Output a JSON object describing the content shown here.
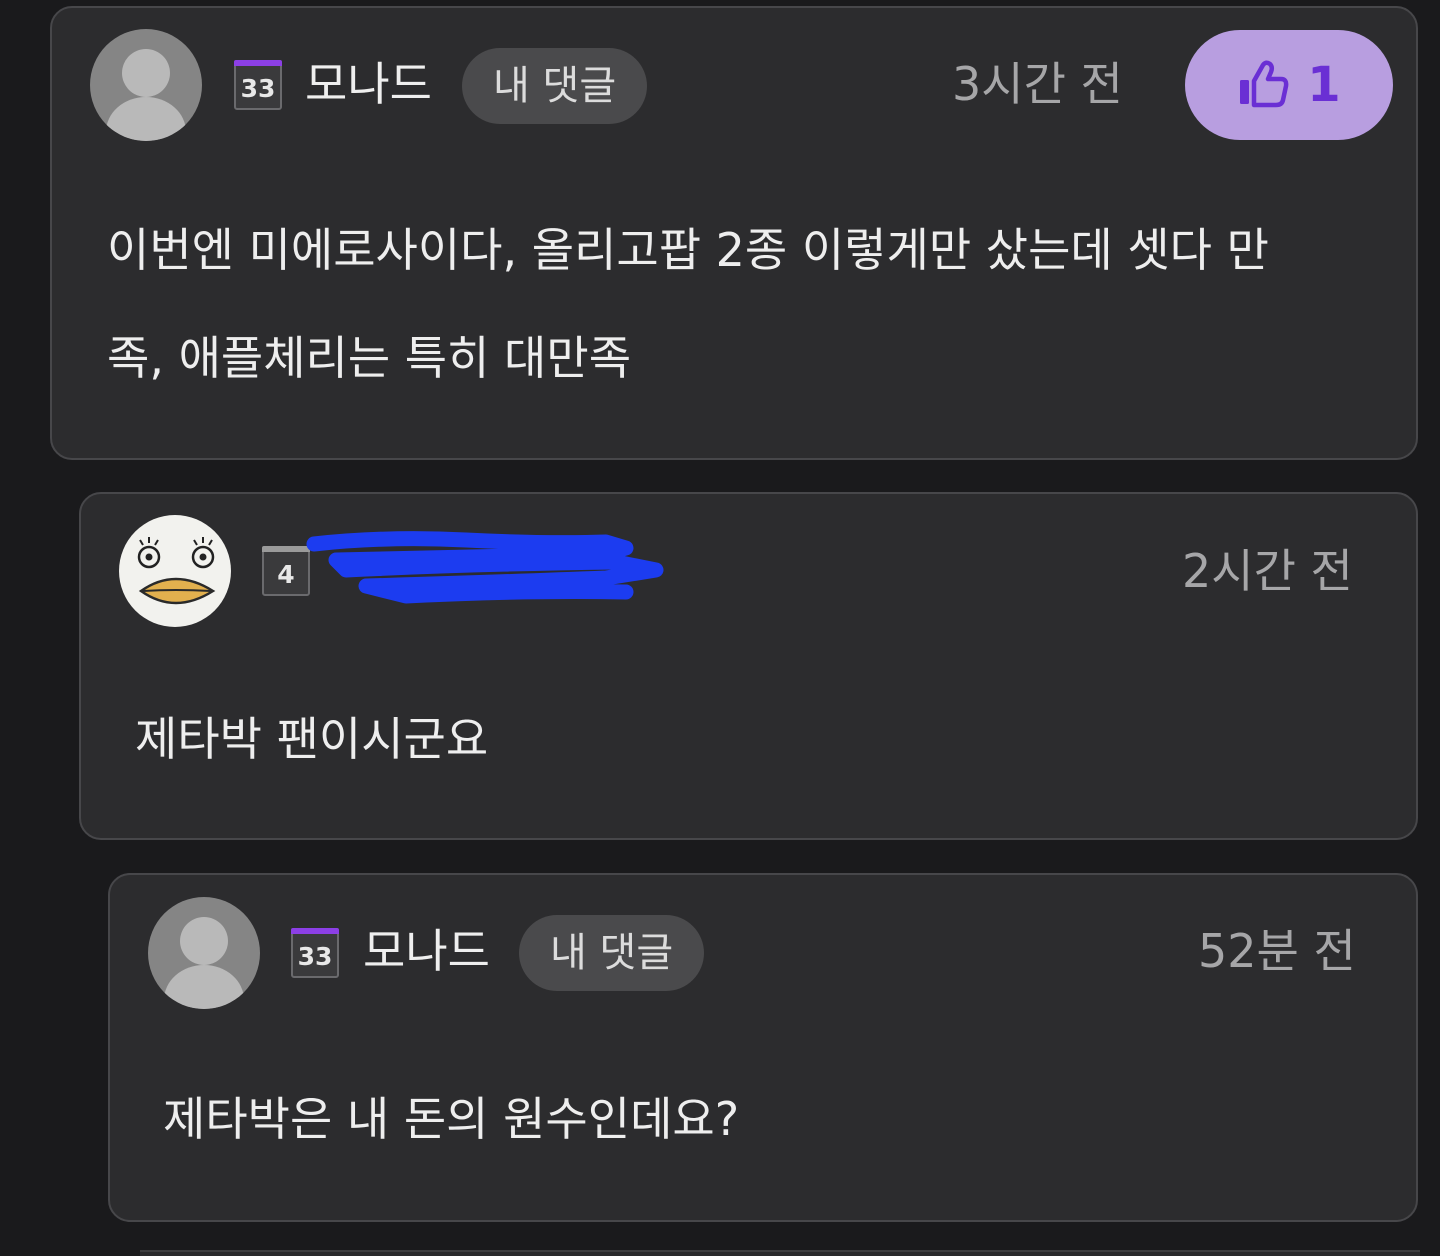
{
  "comments": [
    {
      "badge": {
        "level": "33",
        "color": "#8c3fe6"
      },
      "nickname": "모나드",
      "mine_label": "내 댓글",
      "time": "3시간 전",
      "like": {
        "icon": "thumbs-up-icon",
        "count": "1"
      },
      "lines": [
        "이번엔 미에로사이다, 올리고팝 2종 이렇게만 샀는데 셋다 만",
        "족, 애플체리는 특히 대만족"
      ]
    },
    {
      "badge": {
        "level": "4",
        "color": "#9a9a9a"
      },
      "time": "2시간 전",
      "lines": [
        "제타박 팬이시군요"
      ]
    },
    {
      "badge": {
        "level": "33",
        "color": "#8c3fe6"
      },
      "nickname": "모나드",
      "mine_label": "내 댓글",
      "time": "52분 전",
      "lines": [
        "제타박은 내 돈의 원수인데요?"
      ]
    }
  ]
}
